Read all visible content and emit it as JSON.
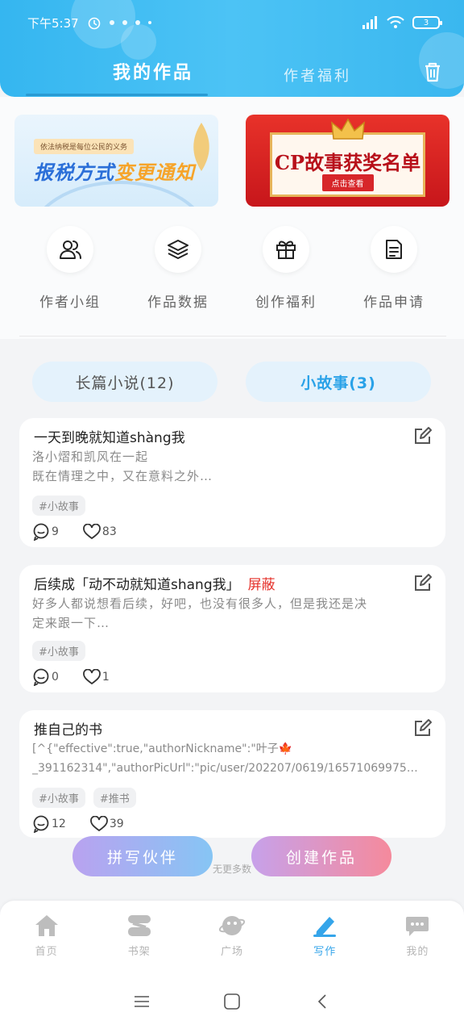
{
  "status": {
    "time": "下午5:37",
    "battery": "3"
  },
  "header": {
    "tab_main": "我的作品",
    "tab_sub": "作者福利"
  },
  "banners": {
    "left_small": "依法纳税是每位公民的义务",
    "left_big_a": "报税方式",
    "left_big_b": "变更通知",
    "right_title": "CP故事获奖名单",
    "right_button": "点击查看"
  },
  "quick_actions": [
    {
      "label": "作者小组",
      "icon": "users-icon"
    },
    {
      "label": "作品数据",
      "icon": "layers-icon"
    },
    {
      "label": "创作福利",
      "icon": "gift-icon"
    },
    {
      "label": "作品申请",
      "icon": "document-icon"
    }
  ],
  "segments": {
    "long": "长篇小说(12)",
    "short": "小故事(3)",
    "active": "short"
  },
  "stories": [
    {
      "title": "一天到晚就知道shàng我",
      "desc_line1": "洛小熠和凯风在一起",
      "desc_line2": "既在情理之中，又在意料之外…",
      "tags": [
        "#小故事"
      ],
      "comments": "9",
      "likes": "83",
      "status": ""
    },
    {
      "title": "后续成「动不动就知道shang我」",
      "status": "屏蔽",
      "desc_line1": "好多人都说想看后续，好吧，也没有很多人，但是我还是决",
      "desc_line2": "定来跟一下…",
      "tags": [
        "#小故事"
      ],
      "comments": "0",
      "likes": "1"
    },
    {
      "title": "推自己的书",
      "status": "",
      "desc_line1": "[^{\"effective\":true,\"authorNickname\":\"叶子🍁",
      "desc_line2": "_391162314\",\"authorPicUrl\":\"pic/user/202207/0619/16571069975…",
      "tags": [
        "#小故事",
        "#推书"
      ],
      "comments": "12",
      "likes": "39"
    }
  ],
  "fabs": {
    "left": "拼写伙伴",
    "right": "创建作品"
  },
  "no_more": "无更多数",
  "bottom_nav": [
    {
      "label": "首页",
      "icon": "home-icon"
    },
    {
      "label": "书架",
      "icon": "bookshelf-icon"
    },
    {
      "label": "广场",
      "icon": "planet-icon"
    },
    {
      "label": "写作",
      "icon": "pen-icon"
    },
    {
      "label": "我的",
      "icon": "chat-icon"
    }
  ],
  "colors": {
    "accent": "#35a5ea",
    "header": "#3ab7ef",
    "blocked": "#e5322b"
  }
}
